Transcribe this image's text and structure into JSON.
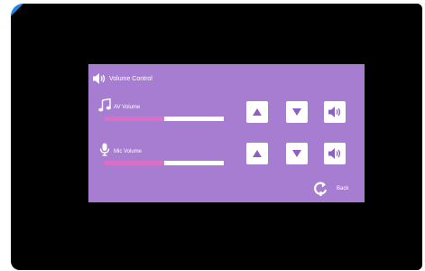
{
  "header": {
    "title": "Volume Control",
    "icon": "speaker-icon"
  },
  "controls": [
    {
      "label": "AV Volume",
      "icon": "music-note-icon",
      "level_percent": 50
    },
    {
      "label": "Mic Volume",
      "icon": "microphone-icon",
      "level_percent": 50
    }
  ],
  "buttons": {
    "up_icon": "triangle-up-icon",
    "down_icon": "triangle-down-icon",
    "sound_icon": "speaker-sound-icon"
  },
  "footer": {
    "back_label": "Back",
    "back_icon": "return-arrow-icon"
  },
  "colors": {
    "panel_bg": "#a77dd1",
    "screen_bg": "#000000",
    "slider_track": "#ffffff",
    "slider_fill": "#d96fc6",
    "button_bg": "#ffffff",
    "button_icon": "#8e5fc5"
  }
}
